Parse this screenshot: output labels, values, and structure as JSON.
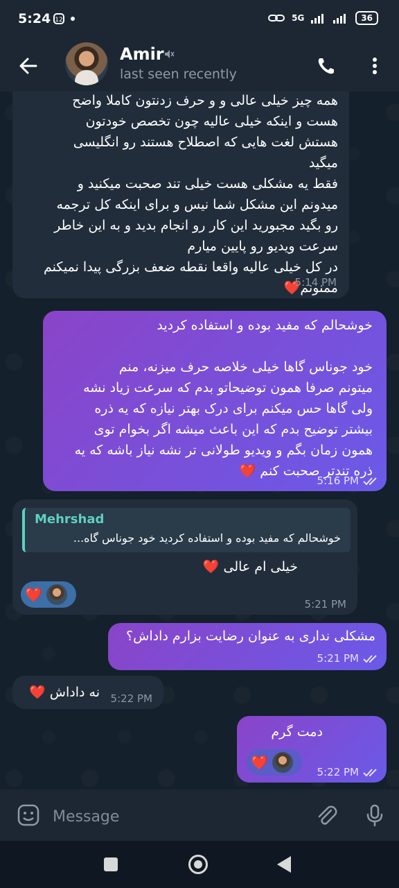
{
  "status_bar": {
    "time": "5:24",
    "network": "5G",
    "battery": "36"
  },
  "header": {
    "name": "Amir",
    "status": "last seen recently"
  },
  "messages": [
    {
      "direction": "in",
      "text": "همه چیز خیلی عالی و و حرف زدنتون کاملا واضح\nهست و اینکه خیلی عالیه چون تخصص خودتون\nهستش لغت هایی که اصطلاح هستند رو انگلیسی\nمیگید\nفقط یه مشکلی هست خیلی تند صحبت میکنید و\nمیدونم این مشکل شما نیس و برای اینکه کل ترجمه\nرو بگید مجبورید این کار رو انجام بدید و به این خاطر\nسرعت ویدیو رو پایین میارم\nدر کل خیلی عالیه واقعا نقطه ضعف بزرگی پیدا نمیکنم\nممنونم❤️",
      "time": "5:14 PM"
    },
    {
      "direction": "out",
      "text": "خوشحالم که مفید بوده و استفاده کردید\n\nخود جوناس گاها خیلی خلاصه حرف میزنه، منم\nمیتونم صرفا همون توضیحاتو بدم که سرعت زیاد نشه\nولی گاها حس میکنم برای درک بهتر نیازه که یه ذره\nبیشتر توضیح بدم که این باعث میشه اگر بخوام توی\nهمون زمان بگم و ویدیو طولانی تر نشه نیاز باشه که یه\nذره تندتر صحبت کنم ❤️",
      "time": "5:16 PM"
    },
    {
      "direction": "in",
      "reply_name": "Mehrshad",
      "reply_text": "خوشحالم که مفید بوده و استفاده کردید  خود جوناس گاه...",
      "text": "خیلی ام عالی ❤️",
      "reaction": "❤️",
      "time": "5:21 PM"
    },
    {
      "direction": "out",
      "text": "مشکلی نداری به عنوان رضایت بزارم داداش؟",
      "time": "5:21 PM"
    },
    {
      "direction": "in",
      "text": "نه داداش ❤️",
      "time": "5:22 PM"
    },
    {
      "direction": "out",
      "text": "دمت گرم",
      "reaction": "❤️",
      "time": "5:22 PM"
    }
  ],
  "input": {
    "placeholder": "Message"
  },
  "colors": {
    "background": "#15202b",
    "incoming_bubble": "#212d3b",
    "outgoing_bubble_start": "#8a44c8",
    "outgoing_bubble_end": "#6a5ae8",
    "reply_accent": "#5fd1c0",
    "time_text": "#8a99a8"
  },
  "icons": {
    "back": "arrow-left-icon",
    "mute": "muted-speaker-icon",
    "call": "phone-icon",
    "more": "vertical-dots-icon",
    "emoji": "emoji-icon",
    "attach": "paperclip-icon",
    "mic": "microphone-icon",
    "read": "double-check-icon"
  }
}
